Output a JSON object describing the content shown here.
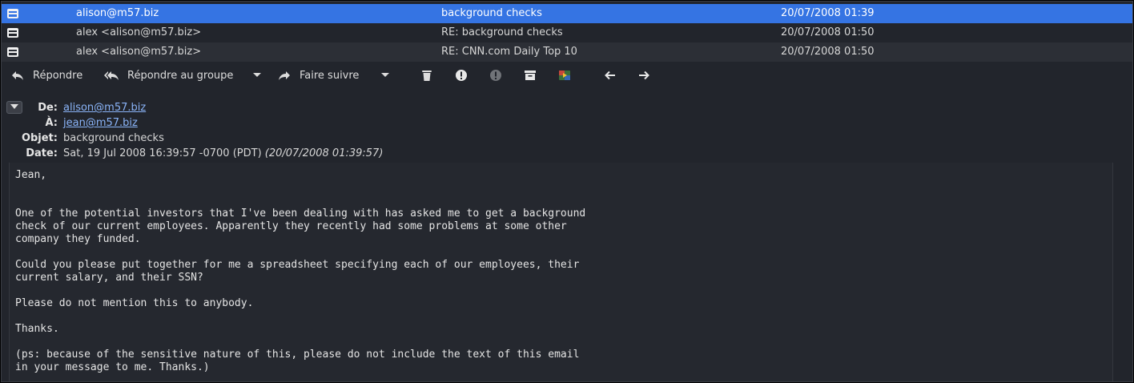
{
  "message_list": [
    {
      "from": "alison@m57.biz",
      "subject": "background checks",
      "date": "20/07/2008 01:39",
      "selected": true
    },
    {
      "from": "alex <alison@m57.biz>",
      "subject": "RE: background checks",
      "date": "20/07/2008 01:50",
      "selected": false
    },
    {
      "from": "alex <alison@m57.biz>",
      "subject": "RE: CNN.com Daily Top 10",
      "date": "20/07/2008 01:50",
      "selected": false
    }
  ],
  "toolbar": {
    "reply_label": "Répondre",
    "reply_all_label": "Répondre au groupe",
    "forward_label": "Faire suivre"
  },
  "header": {
    "from_label": "De:",
    "from_value": "alison@m57.biz",
    "to_label": "À:",
    "to_value": "jean@m57.biz",
    "subject_label": "Objet:",
    "subject_value": "background checks",
    "date_label": "Date:",
    "date_value": "Sat, 19 Jul 2008 16:39:57 -0700 (PDT)",
    "date_local": "(20/07/2008 01:39:57)"
  },
  "body_text": "Jean,\n\n\nOne of the potential investors that I've been dealing with has asked me to get a background\ncheck of our current employees. Apparently they recently had some problems at some other\ncompany they funded.\n\nCould you please put together for me a spreadsheet specifying each of our employees, their\ncurrent salary, and their SSN?\n\nPlease do not mention this to anybody.\n\nThanks.\n\n(ps: because of the sensitive nature of this, please do not include the text of this email\nin your message to me. Thanks.)",
  "colors": {
    "selection": "#3574e3",
    "background": "#22252c",
    "link": "#8ab4f8"
  },
  "icons": [
    "envelope-icon",
    "reply-icon",
    "reply-all-icon",
    "chevron-down-icon",
    "forward-icon",
    "trash-icon",
    "important-icon",
    "junk-icon",
    "archive-icon",
    "tag-icon",
    "arrow-left-icon",
    "arrow-right-icon",
    "collapse-headers-icon"
  ]
}
